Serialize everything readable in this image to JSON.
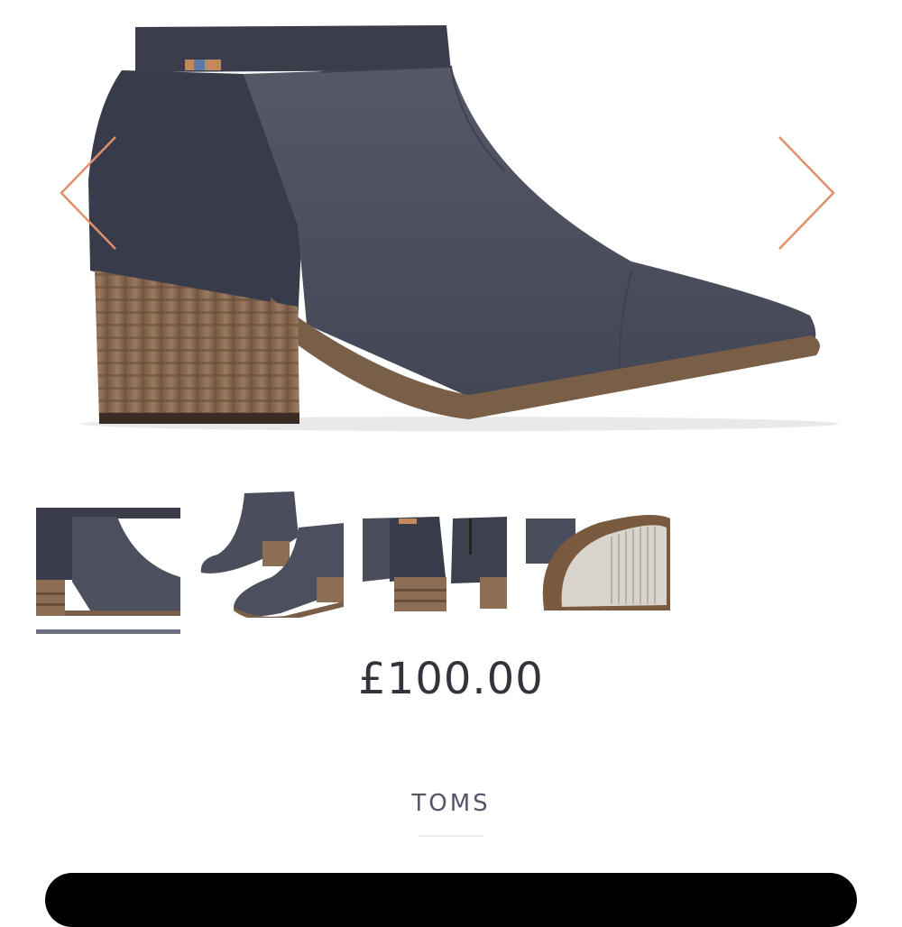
{
  "product": {
    "price": "£100.00",
    "brand": "TOMS",
    "gallery": {
      "main_image": "ankle-boot-side-view",
      "thumbnails": [
        {
          "image": "boot-side-closeup",
          "selected": true
        },
        {
          "image": "boot-pair-angled",
          "selected": false
        },
        {
          "image": "boot-back-and-side",
          "selected": false
        },
        {
          "image": "boot-sole",
          "selected": false
        }
      ],
      "prev_icon": "chevron-left-icon",
      "next_icon": "chevron-right-icon"
    }
  },
  "colors": {
    "arrow": "#e0906a",
    "suede": "#4a4d5c",
    "heel": "#8a6a52",
    "selected_indicator": "#6d7082",
    "button": "#000000"
  }
}
